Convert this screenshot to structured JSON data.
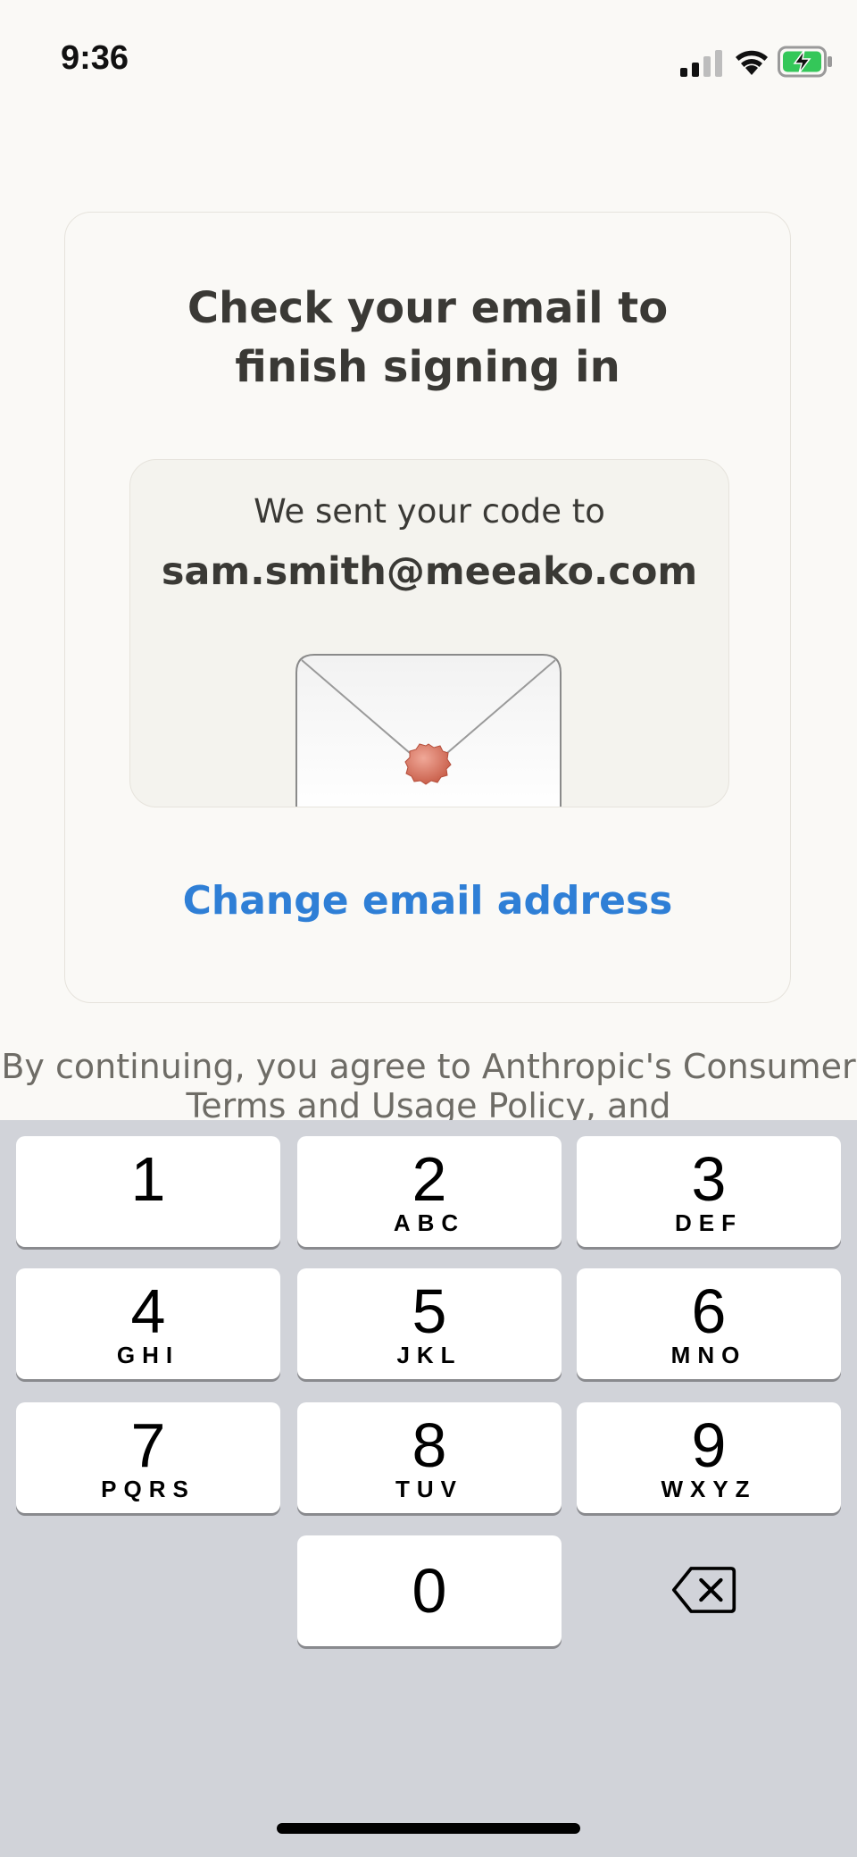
{
  "status_bar": {
    "time": "9:36"
  },
  "card": {
    "title": "Check your email to finish signing in",
    "sent_label": "We sent your code to",
    "email": "sam.smith@meeako.com",
    "change_link": "Change email address"
  },
  "terms_text": "By continuing, you agree to Anthropic's Consumer Terms and Usage Policy, and",
  "keyboard": {
    "keys": [
      {
        "num": "1",
        "letters": ""
      },
      {
        "num": "2",
        "letters": "ABC"
      },
      {
        "num": "3",
        "letters": "DEF"
      },
      {
        "num": "4",
        "letters": "GHI"
      },
      {
        "num": "5",
        "letters": "JKL"
      },
      {
        "num": "6",
        "letters": "MNO"
      },
      {
        "num": "7",
        "letters": "PQRS"
      },
      {
        "num": "8",
        "letters": "TUV"
      },
      {
        "num": "9",
        "letters": "WXYZ"
      },
      {
        "num": "0",
        "letters": ""
      }
    ]
  },
  "colors": {
    "accent": "#2f7fd6",
    "background": "#faf9f6",
    "keyboard_bg": "#d1d3d9",
    "wax_seal": "#d9735f",
    "battery_charging": "#34c759"
  }
}
